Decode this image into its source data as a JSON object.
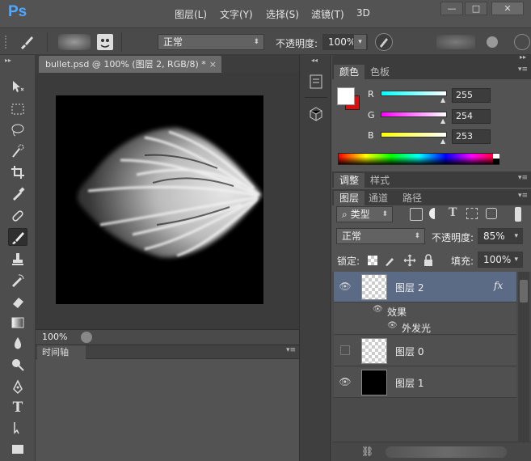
{
  "app": {
    "logo": "Ps"
  },
  "menubar": {
    "items": [
      "图层(L)",
      "文字(Y)",
      "选择(S)",
      "滤镜(T)",
      "3D"
    ]
  },
  "window_controls": {
    "minimize": "—",
    "restore": "□",
    "close": "✕"
  },
  "options_bar": {
    "mode_value": "正常",
    "opacity_label": "不透明度:",
    "opacity_value": "100%"
  },
  "document": {
    "tab_title": "bullet.psd @ 100% (图层 2, RGB/8) *",
    "zoom": "100%"
  },
  "timeline": {
    "title": "时间轴"
  },
  "color_panel": {
    "tabs": [
      "颜色",
      "色板"
    ],
    "channels": [
      {
        "label": "R",
        "value": "255",
        "track": "linear-gradient(90deg,#00ffff,#ffffff)"
      },
      {
        "label": "G",
        "value": "254",
        "track": "linear-gradient(90deg,#ff00ff,#ffffff)"
      },
      {
        "label": "B",
        "value": "253",
        "track": "linear-gradient(90deg,#ffff00,#ffffff)"
      }
    ],
    "foreground": "#ffffff",
    "background": "#d91010"
  },
  "adjust_panel": {
    "tabs": [
      "调整",
      "样式"
    ]
  },
  "layers_panel": {
    "tabs": [
      "图层",
      "通道",
      "路径"
    ],
    "filter_value": "类型",
    "blend_mode": "正常",
    "opacity_label": "不透明度:",
    "opacity_value": "85%",
    "lock_label": "锁定:",
    "fill_label": "填充:",
    "fill_value": "100%",
    "fx": "fx",
    "layers": [
      {
        "name": "图层 2",
        "visible": true,
        "selected": true
      },
      {
        "name": "图层 0",
        "visible": false,
        "selected": false
      },
      {
        "name": "图层 1",
        "visible": true,
        "selected": false
      }
    ],
    "effects_label": "效果",
    "outer_glow_label": "外发光"
  },
  "icons": {
    "eye": "👁",
    "brush": "brush-icon",
    "search": "⌕"
  }
}
